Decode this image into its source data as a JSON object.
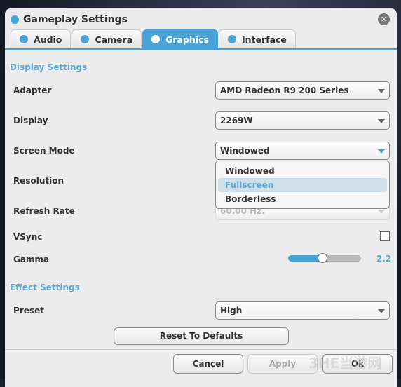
{
  "window": {
    "title": "Gameplay Settings",
    "close_icon": "close-icon"
  },
  "tabs": [
    {
      "label": "Audio",
      "active": false
    },
    {
      "label": "Camera",
      "active": false
    },
    {
      "label": "Graphics",
      "active": true
    },
    {
      "label": "Interface",
      "active": false
    }
  ],
  "display_settings": {
    "heading": "Display Settings",
    "adapter": {
      "label": "Adapter",
      "value": "AMD Radeon R9 200 Series"
    },
    "display": {
      "label": "Display",
      "value": "2269W"
    },
    "screen_mode": {
      "label": "Screen Mode",
      "value": "Windowed",
      "options": [
        "Windowed",
        "Fullscreen",
        "Borderless"
      ],
      "highlighted": "Fullscreen"
    },
    "resolution": {
      "label": "Resolution"
    },
    "refresh_rate": {
      "label": "Refresh Rate",
      "value": "60.00 Hz."
    },
    "vsync": {
      "label": "VSync",
      "checked": false
    },
    "gamma": {
      "label": "Gamma",
      "value": "2.2",
      "fraction": 0.47
    }
  },
  "effect_settings": {
    "heading": "Effect Settings",
    "preset": {
      "label": "Preset",
      "value": "High"
    }
  },
  "buttons": {
    "reset": "Reset To Defaults",
    "cancel": "Cancel",
    "apply": "Apply",
    "ok": "Ok"
  },
  "watermark": "3HE当游网",
  "colors": {
    "accent": "#4aa3d6",
    "panel": "#ececec"
  }
}
